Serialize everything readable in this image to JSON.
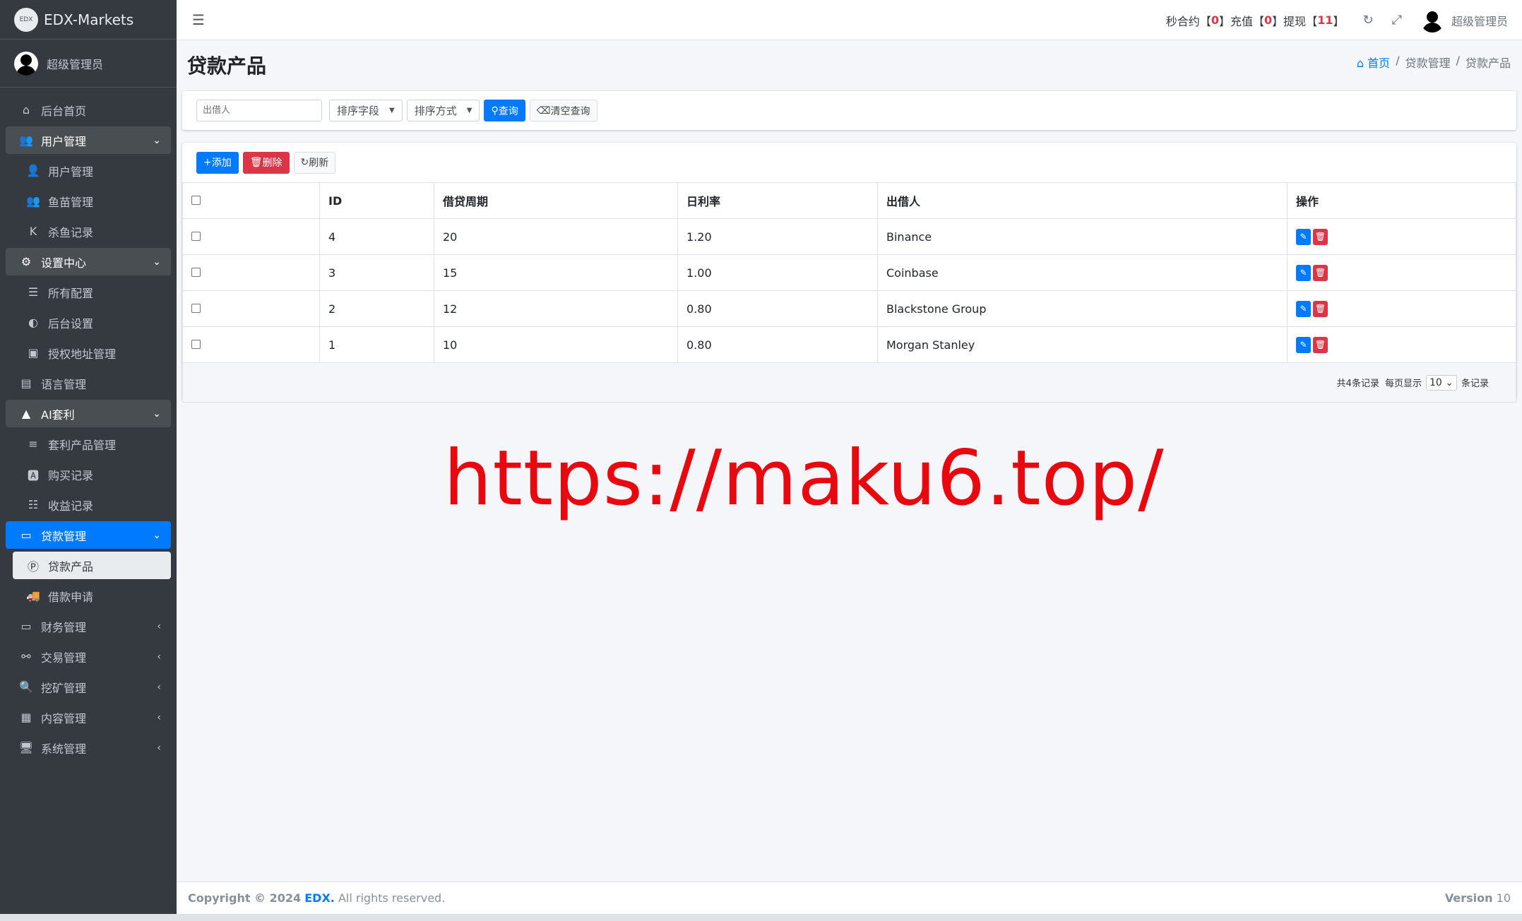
{
  "brand": {
    "logo": "EDX",
    "name": "EDX-Markets"
  },
  "user": {
    "name": "超级管理员"
  },
  "sidebar": {
    "items": [
      {
        "label": "后台首页",
        "icon": "home-icon"
      },
      {
        "label": "用户管理",
        "icon": "users-icon"
      },
      {
        "label": "用户管理",
        "icon": "user-icon"
      },
      {
        "label": "鱼苗管理",
        "icon": "users-icon"
      },
      {
        "label": "杀鱼记录",
        "icon": "k-icon"
      },
      {
        "label": "设置中心",
        "icon": "cogs-icon"
      },
      {
        "label": "所有配置",
        "icon": "list-icon"
      },
      {
        "label": "后台设置",
        "icon": "adjust-icon"
      },
      {
        "label": "授权地址管理",
        "icon": "address-card-icon"
      },
      {
        "label": "语言管理",
        "icon": "language-icon"
      },
      {
        "label": "AI套利",
        "icon": "android-icon"
      },
      {
        "label": "套利产品管理",
        "icon": "bars-icon"
      },
      {
        "label": "购买记录",
        "icon": "font-icon"
      },
      {
        "label": "收益记录",
        "icon": "tasks-icon"
      },
      {
        "label": "贷款管理",
        "icon": "money-icon"
      },
      {
        "label": "贷款产品",
        "icon": "product-p-icon"
      },
      {
        "label": "借款申请",
        "icon": "truck-icon"
      },
      {
        "label": "财务管理",
        "icon": "money-icon"
      },
      {
        "label": "交易管理",
        "icon": "share-icon"
      },
      {
        "label": "挖矿管理",
        "icon": "search-icon"
      },
      {
        "label": "内容管理",
        "icon": "newspaper-icon"
      },
      {
        "label": "系统管理",
        "icon": "desktop-icon"
      }
    ]
  },
  "topbar": {
    "stat1_label": "秒合约",
    "stat1_value": "0",
    "stat2_label": "充值",
    "stat2_value": "0",
    "stat3_label": "提现",
    "stat3_value": "11",
    "user": "超级管理员"
  },
  "page": {
    "title": "贷款产品"
  },
  "breadcrumb": {
    "home": "首页",
    "level1": "贷款管理",
    "level2": "贷款产品"
  },
  "search": {
    "placeholder": "出借人",
    "sort_field": "排序字段",
    "sort_order": "排序方式",
    "query": "查询",
    "clear": "清空查询"
  },
  "toolbar": {
    "add": "添加",
    "delete": "删除",
    "refresh": "刷新"
  },
  "table": {
    "headers": [
      "ID",
      "借贷周期",
      "日利率",
      "出借人",
      "操作"
    ],
    "rows": [
      {
        "id": "4",
        "period": "20",
        "rate": "1.20",
        "lender": "Binance"
      },
      {
        "id": "3",
        "period": "15",
        "rate": "1.00",
        "lender": "Coinbase"
      },
      {
        "id": "2",
        "period": "12",
        "rate": "0.80",
        "lender": "Blackstone Group"
      },
      {
        "id": "1",
        "period": "10",
        "rate": "0.80",
        "lender": "Morgan Stanley"
      }
    ]
  },
  "pager": {
    "total": "共4条记录",
    "per_label": "每页显示",
    "per_value": "10",
    "suffix": "条记录"
  },
  "watermark": "https://maku6.top/",
  "footer": {
    "copyright": "Copyright © 2024",
    "brand": "EDX.",
    "rights": "All rights reserved.",
    "version_label": "Version",
    "version": "10"
  },
  "colors": {
    "sidebar": "#343a40",
    "primary": "#007bff",
    "danger": "#dc3545",
    "watermark": "#e8080f"
  }
}
